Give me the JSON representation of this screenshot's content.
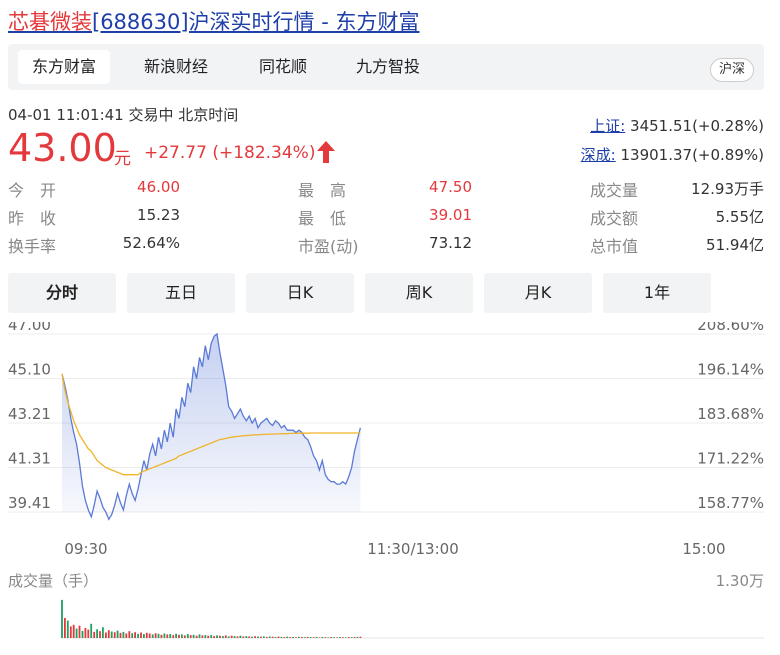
{
  "header": {
    "stock_name": "芯碁微装",
    "title_rest": "[688630]沪深实时行情 - 东方财富"
  },
  "tabs": [
    {
      "label": "东方财富",
      "active": true
    },
    {
      "label": "新浪财经",
      "active": false
    },
    {
      "label": "同花顺",
      "active": false
    },
    {
      "label": "九方智投",
      "active": false
    }
  ],
  "market_button": "沪深",
  "quote": {
    "status": "04-01 11:01:41  交易中  北京时间",
    "price": "43.00",
    "unit": "元",
    "change": "+27.77 (+182.34%)"
  },
  "indices": [
    {
      "label": "上证:",
      "value": "3451.51(+0.28%)"
    },
    {
      "label": "深成:",
      "value": "13901.37(+0.89%)"
    }
  ],
  "stats": [
    [
      {
        "label": "今　开",
        "value": "46.00",
        "red": true
      },
      {
        "label": "最　高",
        "value": "47.50",
        "red": true
      },
      {
        "label": "成交量",
        "value": "12.93万手",
        "red": false
      }
    ],
    [
      {
        "label": "昨　收",
        "value": "15.23",
        "red": false
      },
      {
        "label": "最　低",
        "value": "39.01",
        "red": true
      },
      {
        "label": "成交额",
        "value": "5.55亿",
        "red": false
      }
    ],
    [
      {
        "label": "换手率",
        "value": "52.64%",
        "red": false
      },
      {
        "label": "市盈(动)",
        "value": "73.12",
        "red": false
      },
      {
        "label": "总市值",
        "value": "51.94亿",
        "red": false
      }
    ]
  ],
  "chart_tabs": [
    {
      "label": "分时",
      "active": true
    },
    {
      "label": "五日",
      "active": false
    },
    {
      "label": "日K",
      "active": false
    },
    {
      "label": "周K",
      "active": false
    },
    {
      "label": "月K",
      "active": false
    },
    {
      "label": "1年",
      "active": false
    }
  ],
  "colors": {
    "red": "#e4393c",
    "price_line": "#5b7ad6",
    "avg_line": "#f0b429",
    "green": "#1aa260",
    "link": "#1e3fa8"
  },
  "chart_data": {
    "type": "line",
    "y_ticks_left": [
      "47.00",
      "45.10",
      "43.21",
      "41.31",
      "39.41"
    ],
    "y_ticks_right": [
      "208.60%",
      "196.14%",
      "183.68%",
      "171.22%",
      "158.77%"
    ],
    "ylim": [
      39.41,
      47.0
    ],
    "x_ticks": [
      "09:30",
      "11:30/13:00",
      "15:00"
    ],
    "total_minutes": 240,
    "grid": true,
    "series": [
      {
        "role": "price",
        "values": [
          45.3,
          44.8,
          44.2,
          43.4,
          42.8,
          42.3,
          41.5,
          40.5,
          39.9,
          39.5,
          39.2,
          39.7,
          40.3,
          40.0,
          39.6,
          39.4,
          39.1,
          39.3,
          39.7,
          40.2,
          39.8,
          39.5,
          40.1,
          40.6,
          40.2,
          39.9,
          40.4,
          41.0,
          41.6,
          41.2,
          41.9,
          42.3,
          41.8,
          42.6,
          42.1,
          42.9,
          42.4,
          43.2,
          42.6,
          43.8,
          43.4,
          44.3,
          43.9,
          44.9,
          44.5,
          45.6,
          45.1,
          46.0,
          45.6,
          46.5,
          45.9,
          46.6,
          46.9,
          47.0,
          46.2,
          45.5,
          44.8,
          43.9,
          43.7,
          43.4,
          43.6,
          43.8,
          43.5,
          43.3,
          43.5,
          43.2,
          43.4,
          43.0,
          43.2,
          43.3,
          43.4,
          43.2,
          43.1,
          43.3,
          43.2,
          43.0,
          43.1,
          42.9,
          42.9,
          42.9,
          42.8,
          42.9,
          42.8,
          42.6,
          42.5,
          42.2,
          41.8,
          41.6,
          41.2,
          41.6,
          41.0,
          40.8,
          40.7,
          40.7,
          40.6,
          40.6,
          40.7,
          40.6,
          40.9,
          41.3,
          42.0,
          42.5,
          43.0
        ]
      },
      {
        "role": "average",
        "values": [
          45.3,
          44.6,
          44.1,
          43.7,
          43.3,
          43.0,
          42.7,
          42.5,
          42.3,
          42.1,
          42.0,
          41.8,
          41.6,
          41.5,
          41.4,
          41.3,
          41.25,
          41.2,
          41.15,
          41.1,
          41.05,
          41.0,
          41.0,
          41.0,
          41.0,
          41.0,
          41.0,
          41.1,
          41.15,
          41.2,
          41.25,
          41.3,
          41.35,
          41.4,
          41.45,
          41.5,
          41.55,
          41.6,
          41.65,
          41.7,
          41.8,
          41.85,
          41.9,
          41.95,
          42.0,
          42.05,
          42.1,
          42.15,
          42.2,
          42.25,
          42.3,
          42.35,
          42.4,
          42.45,
          42.5,
          42.52,
          42.55,
          42.58,
          42.6,
          42.62,
          42.63,
          42.65,
          42.66,
          42.67,
          42.68,
          42.69,
          42.7,
          42.7,
          42.71,
          42.72,
          42.72,
          42.73,
          42.73,
          42.74,
          42.74,
          42.75,
          42.75,
          42.75,
          42.76,
          42.76,
          42.76,
          42.77,
          42.77,
          42.77,
          42.77,
          42.78,
          42.78,
          42.78,
          42.78,
          42.78,
          42.78,
          42.78,
          42.78,
          42.78,
          42.78,
          42.78,
          42.78,
          42.78,
          42.78,
          42.78,
          42.78,
          42.78,
          42.78
        ]
      }
    ],
    "volume": {
      "label": "成交量（手）",
      "max_label": "1.30万",
      "max": 13000,
      "values": [
        11800,
        6200,
        5400,
        3600,
        4100,
        2900,
        3800,
        2200,
        3100,
        2600,
        4400,
        1900,
        2700,
        2100,
        3300,
        1700,
        2400,
        2000,
        1800,
        2300,
        1600,
        1900,
        1400,
        2100,
        1500,
        1800,
        1300,
        1700,
        1200,
        1600,
        1400,
        1100,
        1500,
        1300,
        1000,
        1400,
        1100,
        1200,
        900,
        1300,
        1000,
        1100,
        800,
        1200,
        900,
        1000,
        700,
        1100,
        800,
        900,
        700,
        900,
        600,
        800,
        700,
        600,
        800,
        500,
        700,
        600,
        500,
        700,
        450,
        600,
        500,
        400,
        550,
        450,
        400,
        500,
        350,
        450,
        400,
        300,
        450,
        350,
        300,
        400,
        300,
        350,
        250,
        400,
        300,
        250,
        350,
        300,
        250,
        350,
        200,
        300,
        250,
        200,
        300,
        250,
        200,
        300,
        250,
        200,
        300,
        250,
        300,
        350,
        400
      ],
      "colors": [
        "green",
        "red",
        "green",
        "red",
        "red",
        "green",
        "red",
        "green",
        "red",
        "red",
        "green",
        "red",
        "green",
        "red",
        "green",
        "red",
        "red",
        "green",
        "red",
        "green",
        "red",
        "green",
        "red",
        "red",
        "green",
        "red",
        "green",
        "red",
        "green",
        "red",
        "red",
        "green",
        "red",
        "green",
        "red",
        "green",
        "red",
        "green",
        "red",
        "green",
        "red",
        "green",
        "red",
        "green",
        "red",
        "green",
        "red",
        "green",
        "red",
        "green",
        "red",
        "green",
        "red",
        "green",
        "red",
        "green",
        "red",
        "green",
        "red",
        "green",
        "red",
        "green",
        "red",
        "green",
        "red",
        "green",
        "red",
        "green",
        "red",
        "green",
        "red",
        "green",
        "red",
        "green",
        "red",
        "green",
        "red",
        "green",
        "red",
        "green",
        "red",
        "green",
        "red",
        "green",
        "red",
        "green",
        "red",
        "green",
        "red",
        "green",
        "red",
        "green",
        "red",
        "green",
        "red",
        "green",
        "red",
        "green",
        "red",
        "green",
        "red",
        "green",
        "red"
      ]
    }
  }
}
